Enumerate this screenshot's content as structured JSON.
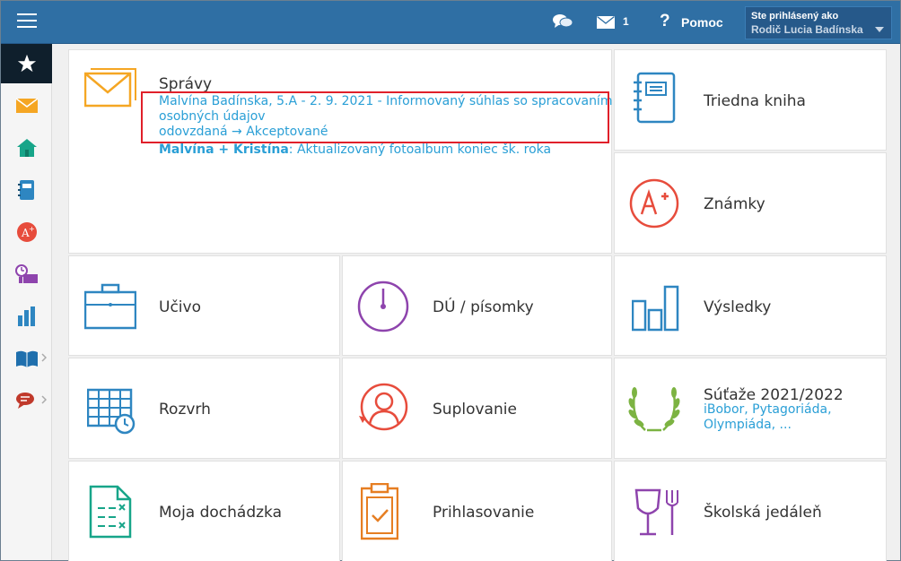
{
  "topbar": {
    "menu_icon": "hamburger-menu-icon",
    "chat_icon": "chat-bubbles-icon",
    "mail_icon": "envelope-icon",
    "mail_count": "1",
    "help_label": "Pomoc",
    "user_line1": "Ste prihlásený ako",
    "user_line2": "Rodič Lucia Badínska",
    "color": "#2f6fa4"
  },
  "sidebar": [
    {
      "name": "favorites",
      "icon": "star-icon"
    },
    {
      "name": "messages",
      "icon": "envelope-icon"
    },
    {
      "name": "home",
      "icon": "house-icon"
    },
    {
      "name": "class-book",
      "icon": "notebook-icon"
    },
    {
      "name": "grades",
      "icon": "grade-a-plus-icon"
    },
    {
      "name": "teacher",
      "icon": "teacher-board-icon"
    },
    {
      "name": "results",
      "icon": "bar-chart-icon"
    },
    {
      "name": "library",
      "icon": "open-book-icon"
    },
    {
      "name": "chat",
      "icon": "chat-icon"
    }
  ],
  "tiles": {
    "spravy": {
      "label": "Správy",
      "msg1": "Malvína Badínska, 5.A - 2. 9. 2021 - Informovaný súhlas so spracovaním",
      "msg1b": "osobných údajov",
      "msg2": "odovzdaná → Akceptované",
      "msg3_bold": "Malvína + Kristína",
      "msg3_rest": ": Aktualizovaný fotoalbum koniec šk. roka"
    },
    "triedna_kniha": "Triedna kniha",
    "znamky": "Známky",
    "ucivo": "Učivo",
    "du": "DÚ / písomky",
    "vysledky": "Výsledky",
    "rozvrh": "Rozvrh",
    "suplovanie": "Suplovanie",
    "sutaze": {
      "label": "Súťaže 2021/2022",
      "sub1": "iBobor, Pytagoriáda,",
      "sub2": "Olympiáda, ..."
    },
    "dochadzka": "Moja dochádzka",
    "prihlasovanie": "Prihlasovanie",
    "jedalen": "Školská jedáleň"
  }
}
